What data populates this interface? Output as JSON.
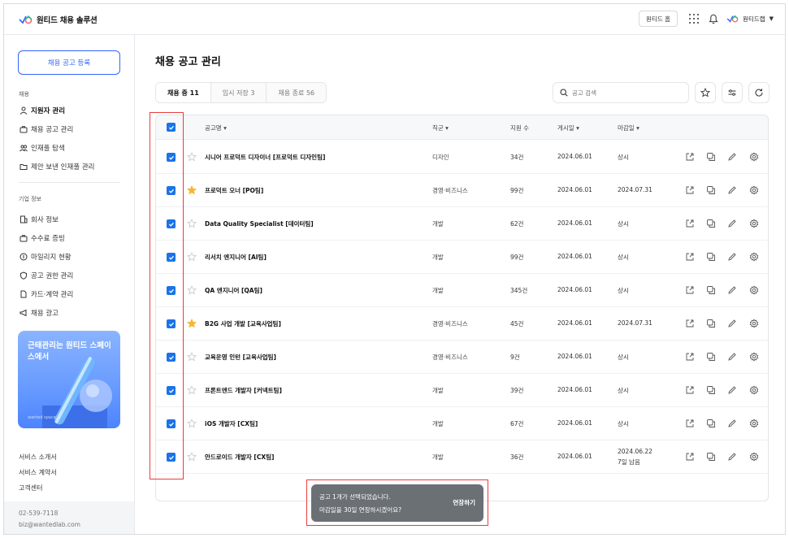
{
  "header": {
    "logo_text": "원티드 채용 솔루션",
    "home_label": "원티드 홈",
    "user_name": "원티드랩",
    "user_caret": "▼"
  },
  "sidebar": {
    "post_button": "채용 공고 등록",
    "section_recruit": "채용",
    "recruit_items": [
      {
        "label": "지원자 관리",
        "icon": "person-icon",
        "active": true
      },
      {
        "label": "채용 공고 관리",
        "icon": "briefcase-icon"
      },
      {
        "label": "인재풀 탐색",
        "icon": "people-icon"
      },
      {
        "label": "제안 보낸 인재풀 관리",
        "icon": "folder-icon"
      }
    ],
    "section_company": "기업 정보",
    "company_items": [
      {
        "label": "회사 정보",
        "icon": "building-icon"
      },
      {
        "label": "수수료 증빙",
        "icon": "receipt-icon"
      },
      {
        "label": "마일리지 현황",
        "icon": "coin-icon"
      },
      {
        "label": "공고 권한 관리",
        "icon": "shield-icon"
      },
      {
        "label": "카드·계약 관리",
        "icon": "document-icon"
      },
      {
        "label": "채용 광고",
        "icon": "megaphone-icon"
      }
    ],
    "banner_text": "근태관리는 원티드 스페이스에서",
    "banner_tag": "wanted space",
    "footer_links": [
      "서비스 소개서",
      "서비스 계약서",
      "고객센터"
    ],
    "contact_phone": "02-539-7118",
    "contact_email": "biz@wantedlab.com"
  },
  "main": {
    "page_title": "채용 공고 관리",
    "tabs": [
      "채용 중 11",
      "임시 저장 3",
      "채용 종료 56"
    ],
    "search_placeholder": "공고 검색",
    "columns": {
      "title": "공고명 ▾",
      "job": "직군 ▾",
      "count": "지원 수",
      "posted": "게시일 ▾",
      "deadline": "마감일 ▾"
    },
    "rows": [
      {
        "title": "시니어 프로덕트 디자이너 [프로덕트 디자인팀]",
        "job": "디자인",
        "count": "34건",
        "posted": "2024.06.01",
        "deadline": "상시",
        "starred": false,
        "checked": true
      },
      {
        "title": "프로덕트 오너 [PO팀]",
        "job": "경영·비즈니스",
        "count": "99건",
        "posted": "2024.06.01",
        "deadline": "2024.07.31",
        "starred": true,
        "checked": true
      },
      {
        "title": "Data Quality Specialist [데이터팀]",
        "job": "개발",
        "count": "62건",
        "posted": "2024.06.01",
        "deadline": "상시",
        "starred": false,
        "checked": true
      },
      {
        "title": "리서치 엔지니어 [AI팀]",
        "job": "개발",
        "count": "99건",
        "posted": "2024.06.01",
        "deadline": "상시",
        "starred": false,
        "checked": true
      },
      {
        "title": "QA 엔지니어 [QA팀]",
        "job": "개발",
        "count": "345건",
        "posted": "2024.06.01",
        "deadline": "상시",
        "starred": false,
        "checked": true
      },
      {
        "title": "B2G 사업 개발 [교육사업팀]",
        "job": "경영·비즈니스",
        "count": "45건",
        "posted": "2024.06.01",
        "deadline": "2024.07.31",
        "starred": true,
        "checked": true
      },
      {
        "title": "교육운영 인턴 [교육사업팀]",
        "job": "경영·비즈니스",
        "count": "9건",
        "posted": "2024.06.01",
        "deadline": "상시",
        "starred": false,
        "checked": true
      },
      {
        "title": "프론트엔드 개발자 [커넥트팀]",
        "job": "개발",
        "count": "39건",
        "posted": "2024.06.01",
        "deadline": "상시",
        "starred": false,
        "checked": true
      },
      {
        "title": "iOS 개발자 [CX팀]",
        "job": "개발",
        "count": "67건",
        "posted": "2024.06.01",
        "deadline": "상시",
        "starred": false,
        "checked": true
      },
      {
        "title": "안드로이드 개발자 [CX팀]",
        "job": "개발",
        "count": "36건",
        "posted": "2024.06.01",
        "deadline": "2024.06.22",
        "deadline_note": "7일 남음",
        "starred": false,
        "checked": true
      }
    ],
    "row_actions": [
      "external-link-icon",
      "copy-icon",
      "edit-icon",
      "settings-icon"
    ]
  },
  "toast": {
    "line1": "공고 1개가 선택되었습니다.",
    "line2": "마감일을 30일 연장하시겠어요?",
    "action": "연장하기"
  },
  "colors": {
    "accent": "#3366ff",
    "checkbox": "#1a73e8",
    "star": "#f5b731",
    "warning": "#e5484d",
    "highlight_box": "#ec3b3b",
    "toast_bg": "#6b7075"
  }
}
